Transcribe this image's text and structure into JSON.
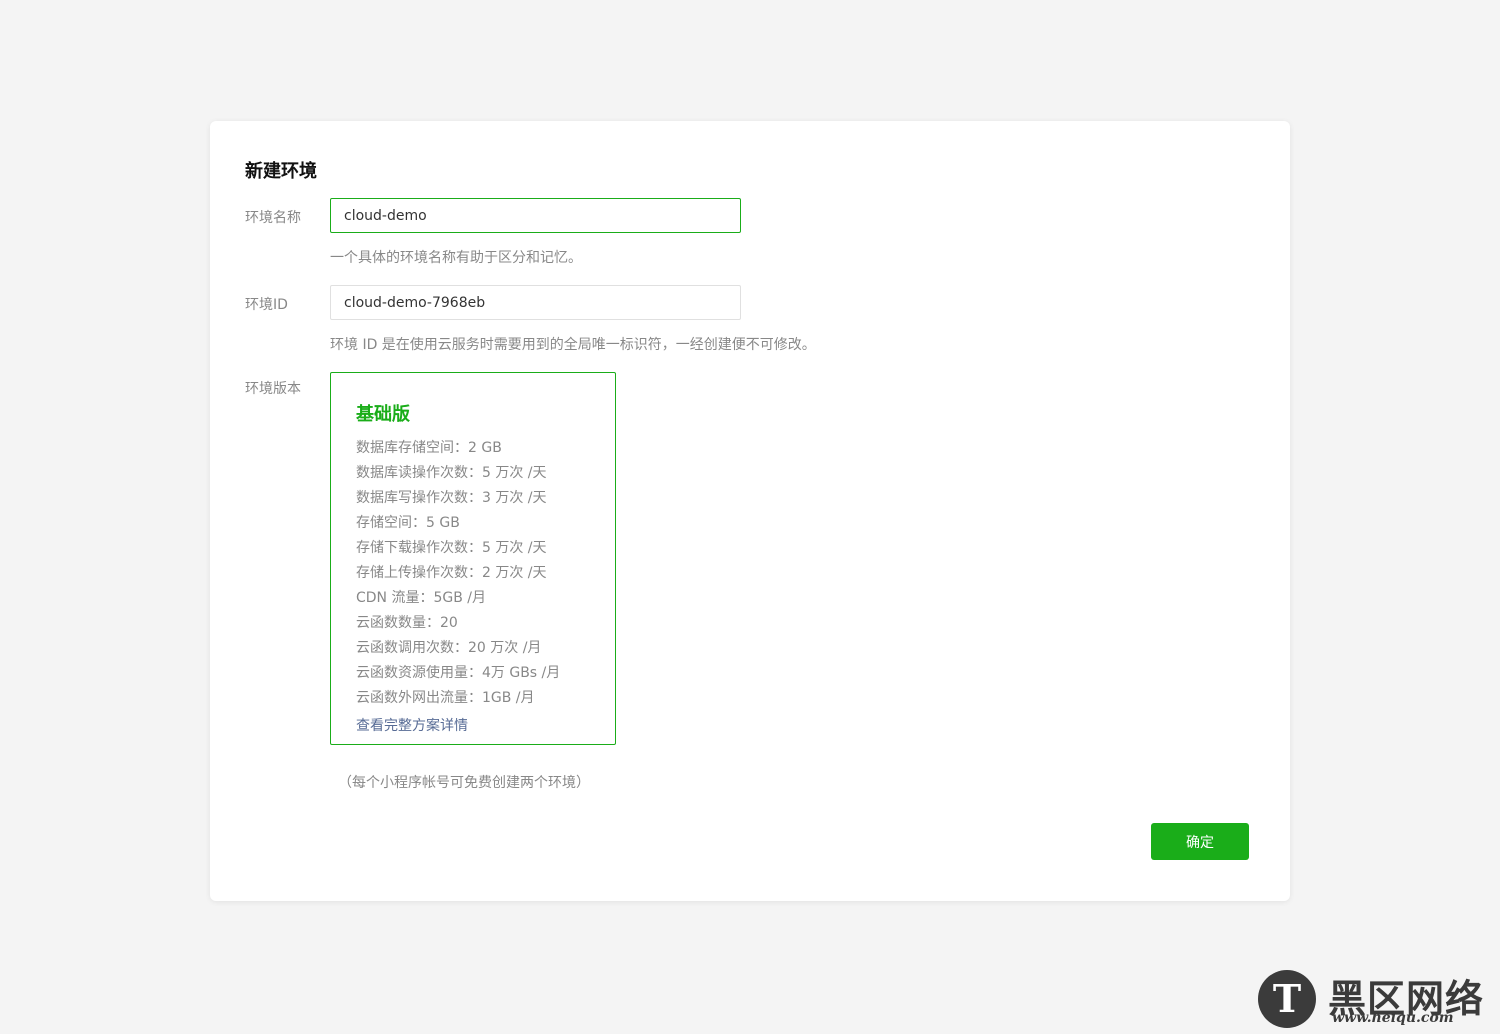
{
  "dialog": {
    "title": "新建环境",
    "env_name": {
      "label": "环境名称",
      "value": "cloud-demo",
      "hint": "一个具体的环境名称有助于区分和记忆。"
    },
    "env_id": {
      "label": "环境ID",
      "value": "cloud-demo-7968eb",
      "hint": "环境 ID 是在使用云服务时需要用到的全局唯一标识符，一经创建便不可修改。"
    },
    "env_version": {
      "label": "环境版本",
      "plan": {
        "name": "基础版",
        "features": [
          "数据库存储空间：2 GB",
          "数据库读操作次数：5 万次 /天",
          "数据库写操作次数：3 万次 /天",
          "存储空间：5 GB",
          "存储下载操作次数：5 万次 /天",
          "存储上传操作次数：2 万次 /天",
          "CDN 流量：5GB /月",
          "云函数数量：20",
          "云函数调用次数：20 万次 /月",
          "云函数资源使用量：4万 GBs /月",
          "云函数外网出流量：1GB /月"
        ],
        "details_link": "查看完整方案详情"
      }
    },
    "note": "（每个小程序帐号可免费创建两个环境）",
    "confirm_label": "确定"
  },
  "watermark": {
    "brand": "黑区网络",
    "url": "www.heiqu.com"
  },
  "colors": {
    "accent": "#1aad19",
    "link": "#576b95",
    "page_bg": "#f4f4f4"
  }
}
